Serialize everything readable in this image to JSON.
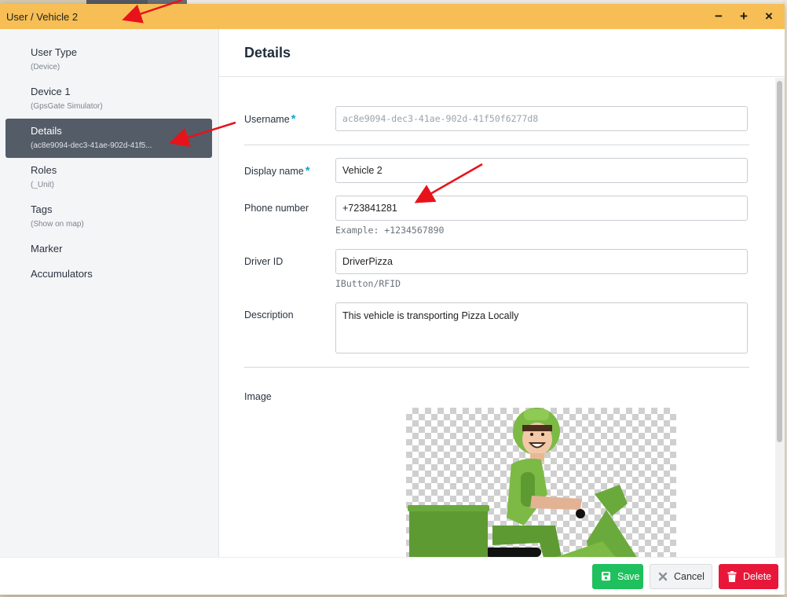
{
  "window": {
    "title": "User / Vehicle 2",
    "controls": {
      "minimize": "−",
      "maximize": "+",
      "close": "×"
    }
  },
  "sidebar": {
    "items": [
      {
        "label": "User Type",
        "sub": "(Device)"
      },
      {
        "label": "Device 1",
        "sub": "(GpsGate Simulator)"
      },
      {
        "label": "Details",
        "sub": "(ac8e9094-dec3-41ae-902d-41f5..."
      },
      {
        "label": "Roles",
        "sub": "(_Unit)"
      },
      {
        "label": "Tags",
        "sub": "(Show on map)"
      },
      {
        "label": "Marker"
      },
      {
        "label": "Accumulators"
      }
    ],
    "active_index": 2
  },
  "main": {
    "title": "Details",
    "form": {
      "username": {
        "label": "Username",
        "value": "ac8e9094-dec3-41ae-902d-41f50f6277d8"
      },
      "display_name": {
        "label": "Display name",
        "value": "Vehicle 2"
      },
      "phone": {
        "label": "Phone number",
        "value": "+723841281",
        "hint": "Example: +1234567890"
      },
      "driver_id": {
        "label": "Driver ID",
        "value": "DriverPizza",
        "hint": "IButton/RFID"
      },
      "description": {
        "label": "Description",
        "value": "This vehicle is transporting Pizza Locally"
      },
      "image": {
        "label": "Image"
      },
      "required_mark": "*"
    }
  },
  "footer": {
    "save": "Save",
    "cancel": "Cancel",
    "delete": "Delete"
  },
  "colors": {
    "titlebar": "#f6be55",
    "active_nav": "#545c67",
    "save": "#1fc05e",
    "delete": "#e8173a",
    "required": "#1aa3c9",
    "annotation_arrow": "#e8121a"
  }
}
